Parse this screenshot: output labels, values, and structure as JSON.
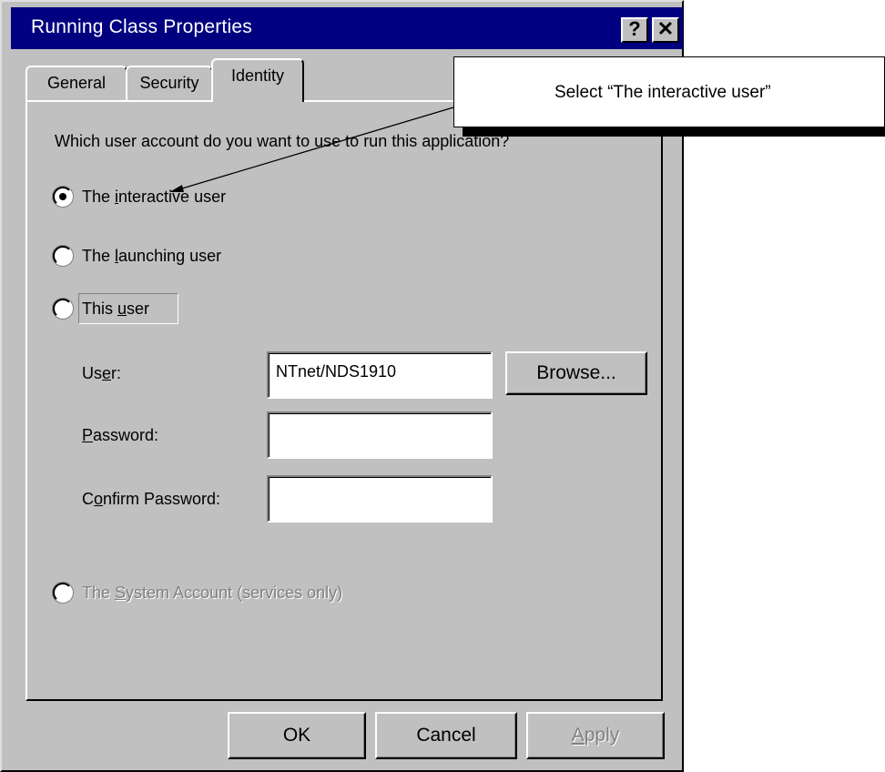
{
  "dialog": {
    "title": "Running Class Properties",
    "help_glyph": "?",
    "close_glyph": "✕"
  },
  "tabs": [
    {
      "label": "General"
    },
    {
      "label": "Security"
    },
    {
      "label": "Identity",
      "selected": true
    }
  ],
  "identity": {
    "question": "Which user account do you want to use to run this application?",
    "options": [
      {
        "pre": "The ",
        "key": "i",
        "post": "nteractive user",
        "selected": true
      },
      {
        "pre": "The ",
        "key": "l",
        "post": "aunching user",
        "selected": false
      },
      {
        "pre": "This ",
        "key": "u",
        "post": "ser",
        "selected": false
      },
      {
        "pre": "The ",
        "key": "S",
        "post": "ystem Account (services only)",
        "selected": false,
        "disabled": true
      }
    ],
    "user_label": {
      "pre": "Us",
      "key": "e",
      "post": "r:"
    },
    "user_value": "NTnet/NDS1910",
    "password_label": {
      "pre": "",
      "key": "P",
      "post": "assword:"
    },
    "password_value": "",
    "confirm_label": {
      "pre": "C",
      "key": "o",
      "post": "nfirm Password:"
    },
    "confirm_value": "",
    "browse_label": "Browse..."
  },
  "buttons": {
    "ok": "OK",
    "cancel": "Cancel",
    "apply": {
      "key": "A",
      "post": "pply"
    }
  },
  "callout": {
    "text": "Select “The interactive user”"
  }
}
